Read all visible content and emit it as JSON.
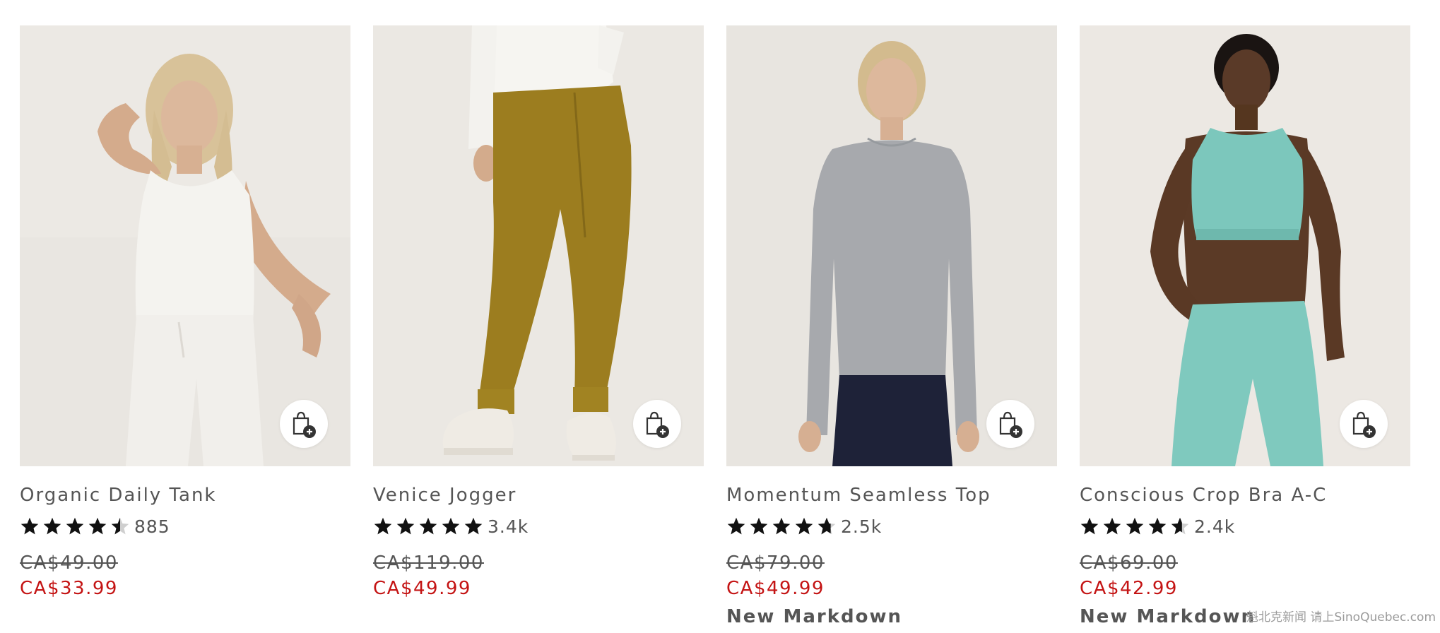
{
  "colors": {
    "sale": "#c41414",
    "text": "#555555",
    "star": "#111111"
  },
  "products": [
    {
      "name": "Organic Daily Tank",
      "rating": 4.5,
      "review_count": "885",
      "original_price": "CA$49.00",
      "sale_price": "CA$33.99",
      "badge": "",
      "quick_add_icon": "shopping-bag-plus-icon"
    },
    {
      "name": "Venice Jogger",
      "rating": 5,
      "review_count": "3.4k",
      "original_price": "CA$119.00",
      "sale_price": "CA$49.99",
      "badge": "",
      "quick_add_icon": "shopping-bag-plus-icon"
    },
    {
      "name": "Momentum Seamless Top",
      "rating": 4.7,
      "review_count": "2.5k",
      "original_price": "CA$79.00",
      "sale_price": "CA$49.99",
      "badge": "New Markdown",
      "quick_add_icon": "shopping-bag-plus-icon"
    },
    {
      "name": "Conscious Crop Bra A-C",
      "rating": 4.6,
      "review_count": "2.4k",
      "original_price": "CA$69.00",
      "sale_price": "CA$42.99",
      "badge": "New Markdown",
      "quick_add_icon": "shopping-bag-plus-icon"
    }
  ],
  "watermark": "魁北克新闻 请上SinoQuebec.com"
}
